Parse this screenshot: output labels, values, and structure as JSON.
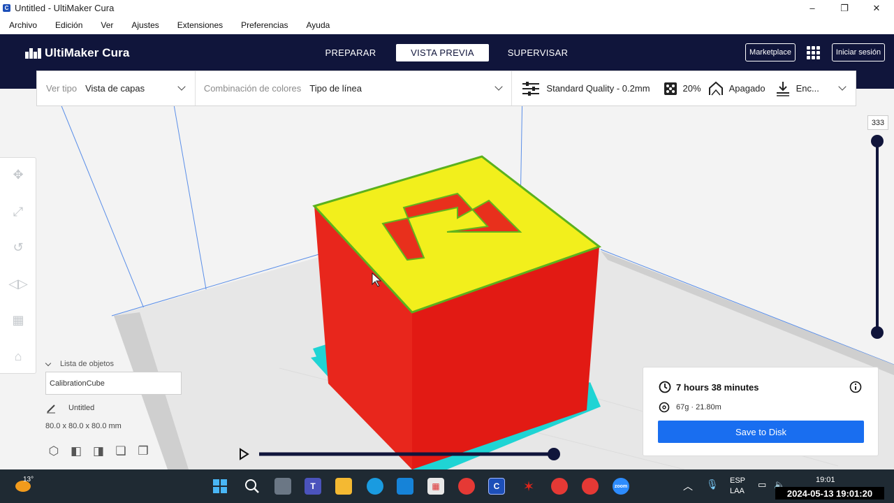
{
  "window": {
    "title": "Untitled - UltiMaker Cura",
    "app_icon": "C",
    "controls": {
      "minimize": "–",
      "maximize": "❐",
      "close": "✕"
    }
  },
  "menu": [
    "Archivo",
    "Edición",
    "Ver",
    "Ajustes",
    "Extensiones",
    "Preferencias",
    "Ayuda"
  ],
  "header": {
    "logo": "UltiMaker Cura",
    "tabs": [
      {
        "label": "PREPARAR",
        "active": false
      },
      {
        "label": "VISTA PREVIA",
        "active": true
      },
      {
        "label": "SUPERVISAR",
        "active": false
      }
    ],
    "marketplace": "Marketplace",
    "signin": "Iniciar sesión"
  },
  "toolbar": {
    "view_type_label": "Ver tipo",
    "view_type_value": "Vista de capas",
    "color_scheme_label": "Combinación de colores",
    "color_scheme_value": "Tipo de línea",
    "quality": "Standard Quality - 0.2mm",
    "infill": "20%",
    "support": "Apagado",
    "adhesion": "Enc..."
  },
  "layer_slider": {
    "max_layer": "333"
  },
  "objects": {
    "list_header": "Lista de objetos",
    "selected_object": "CalibrationCube",
    "project_name": "Untitled",
    "dimensions": "80.0 x 80.0 x 80.0 mm"
  },
  "estimate": {
    "time": "7 hours 38 minutes",
    "material": "67g · 21.80m",
    "save_button": "Save to Disk"
  },
  "taskbar": {
    "weather_temp": "13°",
    "language": "ESP",
    "language_sub": "LAA",
    "clock_time": "19:01",
    "timestamp": "2024-05-13 19:01:20"
  },
  "colors": {
    "header_bg": "#10153b",
    "accent_blue": "#196ef0",
    "model_red": "#e8261c",
    "top_yellow": "#f2ef1c",
    "skirt_cyan": "#1fd4d4",
    "wall_green": "#5bb11e"
  }
}
